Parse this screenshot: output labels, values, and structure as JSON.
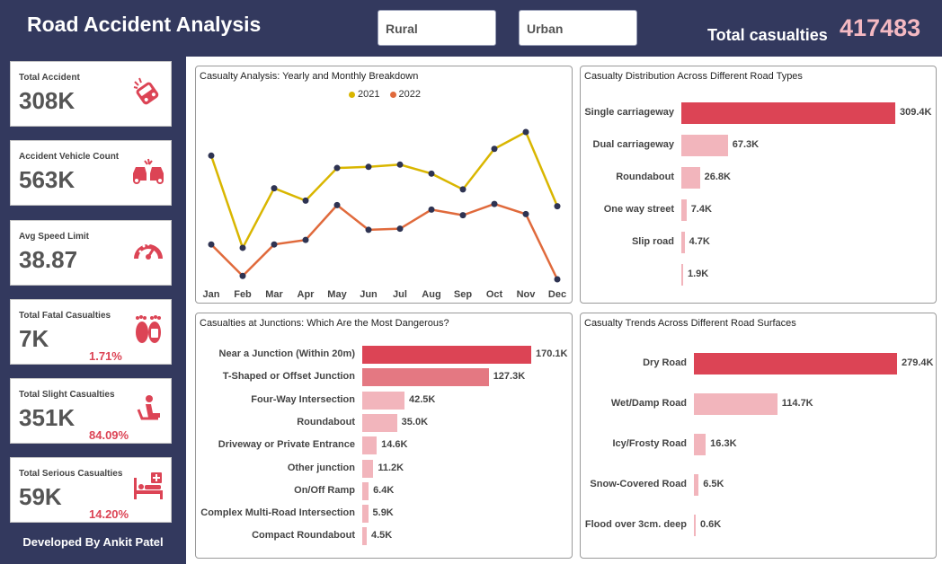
{
  "header": {
    "title": "Road Accident Analysis",
    "filters": [
      {
        "label": "Rural"
      },
      {
        "label": "Urban"
      }
    ],
    "total_label": "Total casualties",
    "total_value": "417483"
  },
  "kpis": [
    {
      "label": "Total Accident",
      "value": "308K",
      "pct": "",
      "icon": "car-crash-icon"
    },
    {
      "label": "Accident Vehicle Count",
      "value": "563K",
      "pct": "",
      "icon": "vehicle-collision-icon"
    },
    {
      "label": "Avg Speed Limit",
      "value": "38.87",
      "pct": "",
      "icon": "speedometer-icon"
    },
    {
      "label": "Total Fatal Casualties",
      "value": "7K",
      "pct": "1.71%",
      "icon": "footprints-tag-icon"
    },
    {
      "label": "Total Slight Casualties",
      "value": "351K",
      "pct": "84.09%",
      "icon": "seated-person-icon"
    },
    {
      "label": "Total Serious Casualties",
      "value": "59K",
      "pct": "14.20%",
      "icon": "hospital-bed-icon"
    }
  ],
  "footer": {
    "developer": "Developed By Ankit Patel"
  },
  "colors": {
    "primary": "#dc4455",
    "secondary": "#f2b5bc",
    "year2021": "#d9b600",
    "year2022": "#e06a3c",
    "dark": "#33395e"
  },
  "charts": {
    "line": {
      "title": "Casualty Analysis: Yearly and Monthly Breakdown"
    },
    "road_types": {
      "title": "Casualty Distribution Across Different Road Types"
    },
    "junctions": {
      "title": "Casualties at Junctions: Which Are the Most Dangerous?"
    },
    "surfaces": {
      "title": "Casualty Trends Across Different Road Surfaces"
    }
  },
  "chart_data": [
    {
      "type": "line",
      "title": "Casualty Analysis: Yearly and Monthly Breakdown",
      "categories": [
        "Jan",
        "Feb",
        "Mar",
        "Apr",
        "May",
        "Jun",
        "Jul",
        "Aug",
        "Sep",
        "Oct",
        "Nov",
        "Dec"
      ],
      "series": [
        {
          "name": "2021",
          "values": [
            100,
            18,
            71,
            60,
            89,
            90,
            92,
            84,
            70,
            106,
            121,
            55
          ]
        },
        {
          "name": "2022",
          "values": [
            21,
            -7,
            21,
            25,
            56,
            34,
            35,
            52,
            47,
            57,
            48,
            -10
          ]
        }
      ],
      "ylim": [
        -10,
        121
      ],
      "legend": "top-center"
    },
    {
      "type": "bar",
      "title": "Casualty Distribution Across Different Road Types",
      "categories": [
        "Single carriageway",
        "Dual carriageway",
        "Roundabout",
        "One way street",
        "Slip road",
        ""
      ],
      "values": [
        309.4,
        67.3,
        26.8,
        7.4,
        4.7,
        1.9
      ],
      "labels": [
        "309.4K",
        "67.3K",
        "26.8K",
        "7.4K",
        "4.7K",
        "1.9K"
      ],
      "max": 309.4
    },
    {
      "type": "bar",
      "title": "Casualties at Junctions: Which Are the Most Dangerous?",
      "categories": [
        "Near a Junction (Within 20m)",
        "T-Shaped or Offset Junction",
        "Four-Way Intersection",
        "Roundabout",
        "Driveway or Private Entrance",
        "Other junction",
        "On/Off Ramp",
        "Complex Multi-Road Intersection",
        "Compact Roundabout"
      ],
      "values": [
        170.1,
        127.3,
        42.5,
        35.0,
        14.6,
        11.2,
        6.4,
        5.9,
        4.5
      ],
      "labels": [
        "170.1K",
        "127.3K",
        "42.5K",
        "35.0K",
        "14.6K",
        "11.2K",
        "6.4K",
        "5.9K",
        "4.5K"
      ],
      "max": 170.1
    },
    {
      "type": "bar",
      "title": "Casualty Trends Across Different Road Surfaces",
      "categories": [
        "Dry Road",
        "Wet/Damp Road",
        "Icy/Frosty Road",
        "Snow-Covered Road",
        "Flood over 3cm. deep"
      ],
      "values": [
        279.4,
        114.7,
        16.3,
        6.5,
        0.6
      ],
      "labels": [
        "279.4K",
        "114.7K",
        "16.3K",
        "6.5K",
        "0.6K"
      ],
      "max": 279.4
    }
  ]
}
